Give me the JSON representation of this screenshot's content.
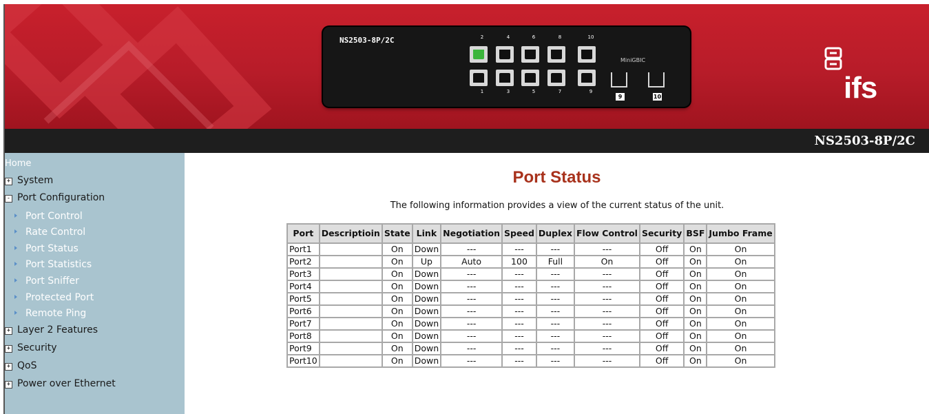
{
  "header": {
    "switch_model": "NS2503-8P/2C",
    "port_numbers_top": [
      "2",
      "4",
      "6",
      "8",
      "10"
    ],
    "port_numbers_bottom": [
      "1",
      "3",
      "5",
      "7",
      "9"
    ],
    "minigbic_label": "MiniGBIC",
    "sfp_labels": [
      "9",
      "10"
    ],
    "brand": "ifs",
    "device_name": "NS2503-8P/2C",
    "active_port": "2"
  },
  "sidebar": {
    "home": "Home",
    "items": [
      {
        "label": "System",
        "marker": "+"
      },
      {
        "label": "Port Configuration",
        "marker": "-"
      },
      {
        "label": "Layer 2 Features",
        "marker": "+"
      },
      {
        "label": "Security",
        "marker": "+"
      },
      {
        "label": "QoS",
        "marker": "+"
      },
      {
        "label": "Power over Ethernet",
        "marker": "+"
      }
    ],
    "subitems": [
      "Port Control",
      "Rate Control",
      "Port Status",
      "Port Statistics",
      "Port Sniffer",
      "Protected Port",
      "Remote Ping"
    ]
  },
  "main": {
    "title": "Port Status",
    "description": "The following information provides a view of the current status of the unit.",
    "columns": [
      "Port",
      "Descriptioin",
      "State",
      "Link",
      "Negotiation",
      "Speed",
      "Duplex",
      "Flow Control",
      "Security",
      "BSF",
      "Jumbo Frame"
    ],
    "rows": [
      [
        "Port1",
        "",
        "On",
        "Down",
        "---",
        "---",
        "---",
        "---",
        "Off",
        "On",
        "On"
      ],
      [
        "Port2",
        "",
        "On",
        "Up",
        "Auto",
        "100",
        "Full",
        "On",
        "Off",
        "On",
        "On"
      ],
      [
        "Port3",
        "",
        "On",
        "Down",
        "---",
        "---",
        "---",
        "---",
        "Off",
        "On",
        "On"
      ],
      [
        "Port4",
        "",
        "On",
        "Down",
        "---",
        "---",
        "---",
        "---",
        "Off",
        "On",
        "On"
      ],
      [
        "Port5",
        "",
        "On",
        "Down",
        "---",
        "---",
        "---",
        "---",
        "Off",
        "On",
        "On"
      ],
      [
        "Port6",
        "",
        "On",
        "Down",
        "---",
        "---",
        "---",
        "---",
        "Off",
        "On",
        "On"
      ],
      [
        "Port7",
        "",
        "On",
        "Down",
        "---",
        "---",
        "---",
        "---",
        "Off",
        "On",
        "On"
      ],
      [
        "Port8",
        "",
        "On",
        "Down",
        "---",
        "---",
        "---",
        "---",
        "Off",
        "On",
        "On"
      ],
      [
        "Port9",
        "",
        "On",
        "Down",
        "---",
        "---",
        "---",
        "---",
        "Off",
        "On",
        "On"
      ],
      [
        "Port10",
        "",
        "On",
        "Down",
        "---",
        "---",
        "---",
        "---",
        "Off",
        "On",
        "On"
      ]
    ]
  },
  "colors": {
    "banner_red": "#b71c29",
    "title_bar": "#1e1e1e",
    "sidebar_bg": "#a9c4cf",
    "page_title": "#a8321c",
    "active_port_led": "#3bb53b"
  },
  "icons": {
    "expand": "plus-box-icon",
    "collapse": "minus-box-icon",
    "submenu": "triangle-right-icon",
    "brand": "ifs-logo-icon"
  }
}
